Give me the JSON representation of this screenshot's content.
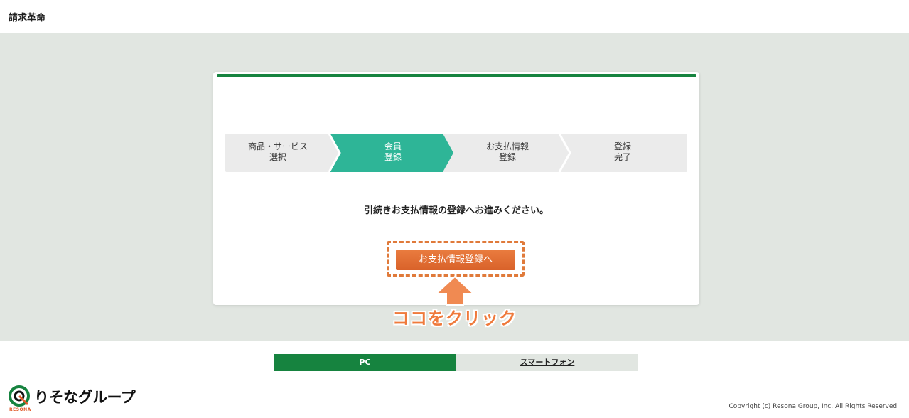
{
  "header": {
    "title": "請求革命"
  },
  "steps": [
    {
      "line1": "商品・サービス",
      "line2": "選択",
      "active": false
    },
    {
      "line1": "会員",
      "line2": "登録",
      "active": true
    },
    {
      "line1": "お支払情報",
      "line2": "登録",
      "active": false
    },
    {
      "line1": "登録",
      "line2": "完了",
      "active": false
    }
  ],
  "main": {
    "guide_text": "引続きお支払情報の登録へお進みください。",
    "payment_button_label": "お支払情報登録へ",
    "click_hint": "ココをクリック"
  },
  "footer": {
    "view_pc": "PC",
    "view_smartphone": "スマートフォン",
    "logo_text": "りそなグループ",
    "logo_sub": "RESONA",
    "copyright": "Copyright (c) Resona Group, Inc. All Rights Reserved."
  },
  "colors": {
    "brand_green": "#16833f",
    "active_step": "#2eb597",
    "accent_orange": "#e06a30",
    "background": "#e1e6e1"
  }
}
